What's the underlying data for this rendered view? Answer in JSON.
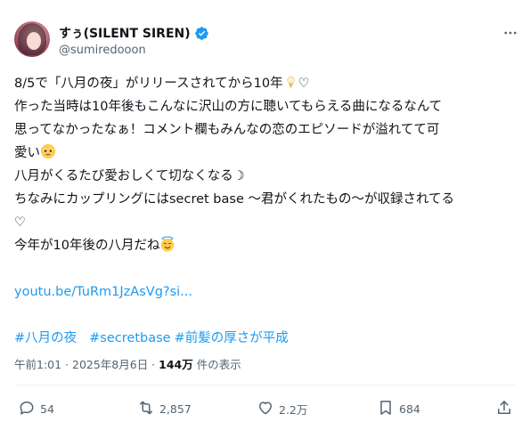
{
  "author": {
    "display_name": "すぅ(SILENT SIREN)",
    "handle": "@sumiredooon",
    "verified": true
  },
  "tweet": {
    "lines": [
      "8/5で「八月の夜」がリリースされてから10年",
      "作った当時は10年後もこんなに沢山の方に聴いてもらえる曲になるなんて",
      "思ってなかったなぁ！コメント欄もみんなの恋のエピソードが溢れてて可",
      "愛い",
      "八月がくるたび愛おしくて切なくなる",
      "ちなみにカップリングにはsecret base 〜君がくれたもの〜が収録されてる",
      "♡",
      "今年が10年後の八月だね"
    ],
    "heart_glyph": "♡",
    "moon_glyph": "☽",
    "link": "youtu.be/TuRm1JzAsVg?si...",
    "hashtags": [
      "#八月の夜",
      "#secretbase",
      "#前髪の厚さが平成"
    ]
  },
  "meta": {
    "time": "午前1:01 · 2025年8月6日 · ",
    "views_count": "144万",
    "views_label": " 件の表示"
  },
  "actions": {
    "replies": "54",
    "reposts": "2,857",
    "likes": "2.2万",
    "bookmarks": "684"
  },
  "colors": {
    "text": "#0f1419",
    "secondary": "#536471",
    "link": "#1d9bf0",
    "verified": "#1d9bf0",
    "divider": "#eff3f4"
  }
}
